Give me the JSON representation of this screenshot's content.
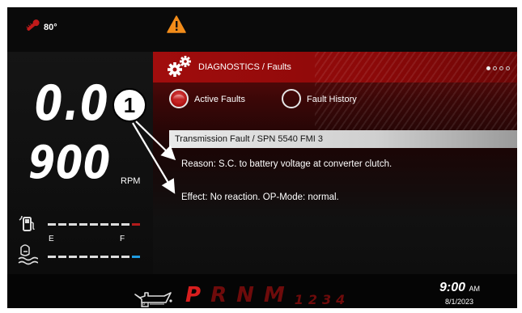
{
  "status": {
    "temperature": "80°",
    "icons": [
      "thermometer-icon",
      "warning-icon"
    ]
  },
  "gauges": {
    "speed": "0.0",
    "rpm": "900",
    "rpm_unit": "RPM",
    "fuel": {
      "icon": "fuel-pump-icon",
      "empty_label": "E",
      "full_label": "F"
    },
    "water": {
      "icon": "water-temp-icon"
    }
  },
  "diagnostics": {
    "title": "DIAGNOSTICS / Faults",
    "page_indicator": {
      "pages": 4,
      "current": 1
    },
    "tabs": [
      {
        "label": "Active Faults",
        "selected": true
      },
      {
        "label": "Fault History",
        "selected": false
      }
    ],
    "fault": {
      "title": "Transmission Fault / SPN 5540 FMI 3",
      "reason": "Reason: S.C. to battery voltage at converter clutch.",
      "effect": "Effect: No reaction. OP-Mode: normal."
    }
  },
  "footer": {
    "gear_selector": [
      "P",
      "R",
      "N",
      "M"
    ],
    "active_gear": "P",
    "manual_gears": [
      "1",
      "2",
      "3",
      "4"
    ],
    "time": "9:00",
    "ampm": "AM",
    "date": "8/1/2023"
  },
  "callout": {
    "number": "1"
  },
  "colors": {
    "accent_red": "#a10d0d",
    "active_gear": "#d81e1e",
    "water_bar_end": "#1f9be0"
  }
}
